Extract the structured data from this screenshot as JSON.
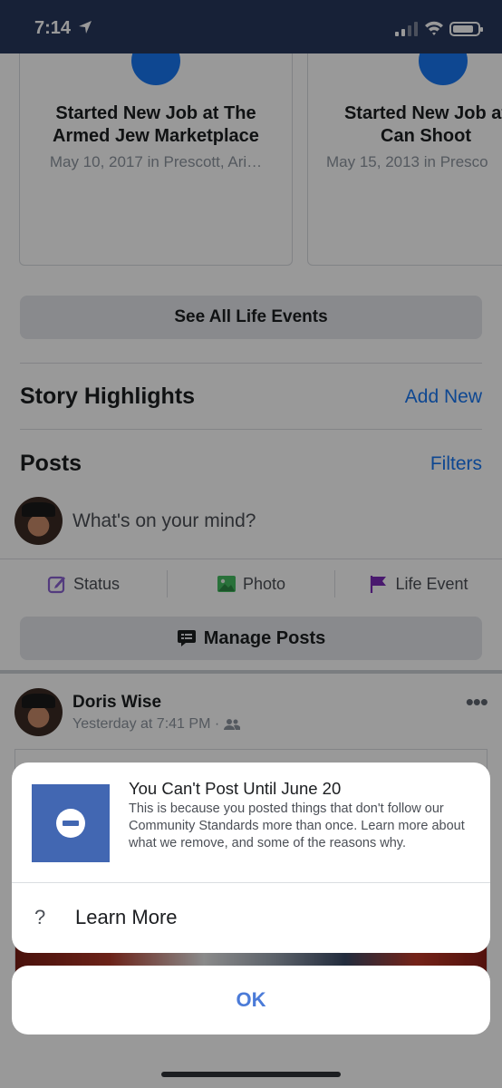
{
  "status_bar": {
    "time": "7:14"
  },
  "life_events": [
    {
      "title": "Started New Job at The Armed Jew Marketplace",
      "subtitle": "May 10, 2017 in Prescott, Ari…"
    },
    {
      "title": "Started New Job at Can Shoot",
      "subtitle": "May 15, 2013 in Presco"
    }
  ],
  "see_all_label": "See All Life Events",
  "story_highlights": {
    "title": "Story Highlights",
    "action": "Add New"
  },
  "posts": {
    "title": "Posts",
    "action": "Filters"
  },
  "composer": {
    "placeholder": "What's on your mind?"
  },
  "actions": [
    {
      "label": "Status",
      "icon": "edit-icon",
      "color": "#8a63d2"
    },
    {
      "label": "Photo",
      "icon": "photo-icon",
      "color": "#45bd62"
    },
    {
      "label": "Life Event",
      "icon": "flag-icon",
      "color": "#7a2ab8"
    }
  ],
  "manage_posts_label": "Manage Posts",
  "post": {
    "author": "Doris Wise",
    "time": "Yesterday at 7:41 PM ·",
    "audience_icon": "friends-icon"
  },
  "dialog": {
    "title": "You Can't Post Until June 20",
    "body": "This is because you posted things that don't follow our Community Standards more than once. Learn more about what we remove, and some of the reasons why.",
    "learn_more": "Learn More",
    "ok": "OK"
  },
  "colors": {
    "brand": "#4267b2",
    "link": "#1877f2",
    "status_bar": "#27375c"
  }
}
